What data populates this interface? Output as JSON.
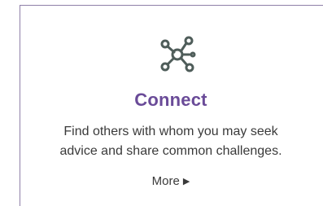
{
  "card": {
    "icon": "network-connect-icon",
    "title": "Connect",
    "description_line1": "Find others with whom you may seek",
    "description_line2": "advice and share common challenges.",
    "more_label": "More",
    "more_icon": "triangle-right-icon"
  },
  "colors": {
    "title": "#6a4b98",
    "text": "#3a3a3a",
    "border": "#8f7fa8",
    "icon": "#4f5d5a"
  }
}
